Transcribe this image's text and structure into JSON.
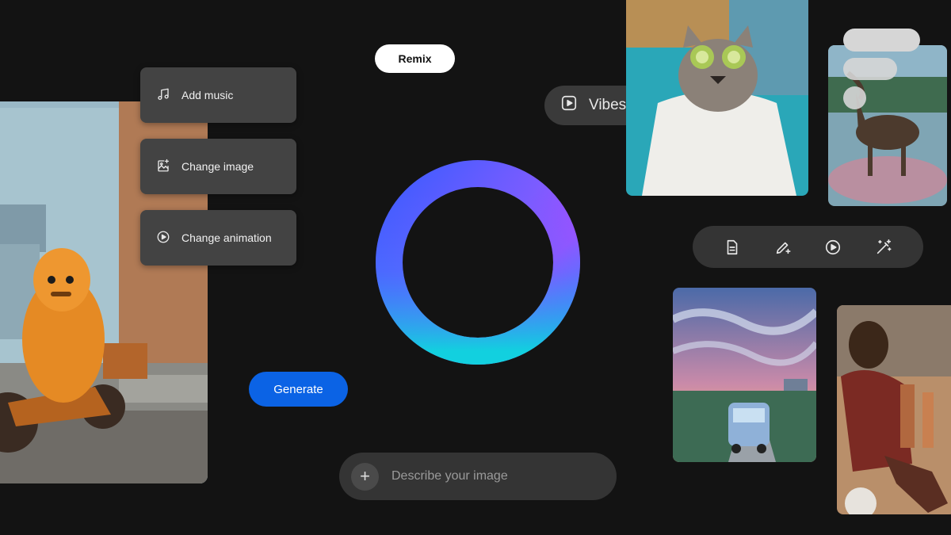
{
  "menu": {
    "items": [
      {
        "label": "Add music",
        "icon": "music-note-icon"
      },
      {
        "label": "Change image",
        "icon": "image-sparkle-icon"
      },
      {
        "label": "Change animation",
        "icon": "play-circle-icon"
      }
    ]
  },
  "remix": {
    "label": "Remix"
  },
  "vibes": {
    "label": "Vibes",
    "icon": "play-square-icon"
  },
  "generate": {
    "label": "Generate"
  },
  "prompt": {
    "placeholder": "Describe your image",
    "add_icon": "plus-icon"
  },
  "toolbar": {
    "tools": [
      "document-icon",
      "pencil-sparkle-icon",
      "play-circle-icon",
      "magic-wand-icon"
    ]
  },
  "colors": {
    "background": "#131313",
    "accent_blue": "#0b63e5",
    "ring_gradient": [
      "#3b5cff",
      "#b44cff",
      "#18c4e0"
    ]
  }
}
